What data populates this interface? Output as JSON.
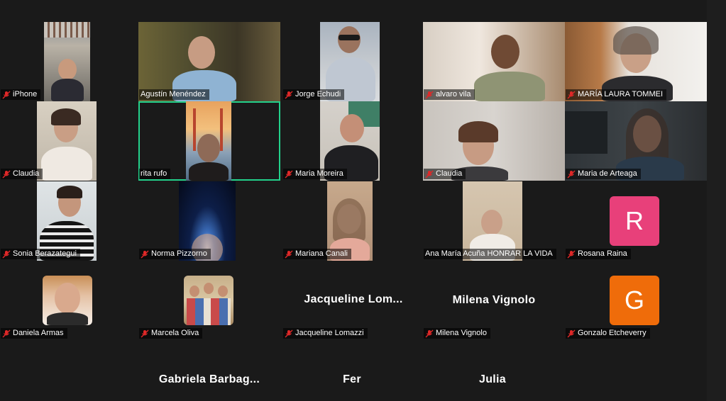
{
  "participants": [
    {
      "name": "iPhone"
    },
    {
      "name": "Agustín Menéndez"
    },
    {
      "name": "Jorge Echudi"
    },
    {
      "name": "alvaro vila"
    },
    {
      "name": "MARÍA LAURA TOMMEI"
    },
    {
      "name": "Claudia"
    },
    {
      "name": "rita rufo"
    },
    {
      "name": "Maria Moreira"
    },
    {
      "name": "Claudia"
    },
    {
      "name": "Maria de Arteaga"
    },
    {
      "name": "Sonia Berazategui"
    },
    {
      "name": "Norma Pizzorno"
    },
    {
      "name": "Mariana Canali"
    },
    {
      "name": "Ana María Acuña HONRAR LA VIDA"
    },
    {
      "name": "Rosana Raina",
      "initial": "R",
      "avatar_color": "#e8407a"
    },
    {
      "name": "Daniela Armas"
    },
    {
      "name": "Marcela Oliva"
    },
    {
      "name": "Jacqueline Lomazzi",
      "display": "Jacqueline  Lom..."
    },
    {
      "name": "Milena Vignolo",
      "display": "Milena Vignolo"
    },
    {
      "name": "Gonzalo Etcheverry",
      "initial": "G",
      "avatar_color": "#ef6c0a"
    },
    {
      "display": "Gabriela  Barbag..."
    },
    {
      "display": "Fer"
    },
    {
      "display": "Julia"
    }
  ],
  "colors": {
    "background": "#1a1a1a",
    "active_speaker": "#23d18b",
    "mute": "#e02828"
  },
  "icons": {
    "mute": "microphone-muted-icon"
  }
}
